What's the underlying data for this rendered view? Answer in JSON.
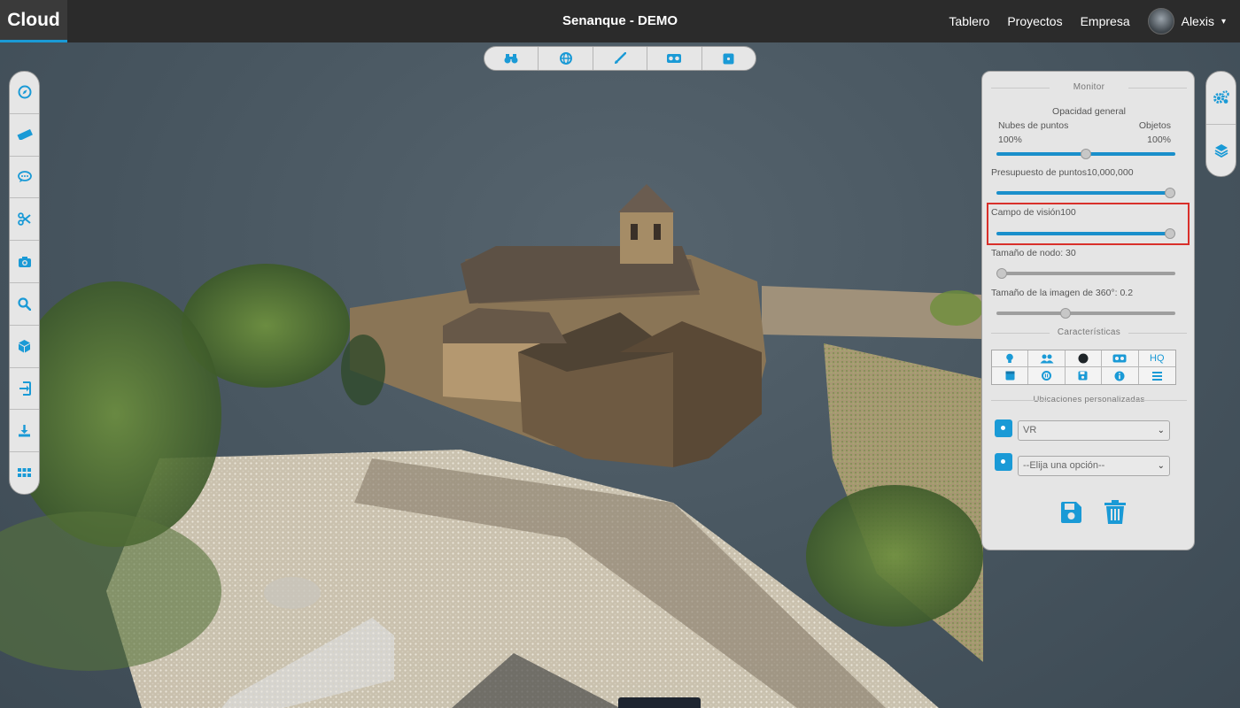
{
  "header": {
    "brand": "Cloud",
    "title": "Senanque - DEMO",
    "nav": [
      "Tablero",
      "Proyectos",
      "Empresa"
    ],
    "user_name": "Alexis"
  },
  "toolbar_top": {
    "buttons": [
      "binoculars-icon",
      "globe-icon",
      "paintbrush-icon",
      "vr-goggles-icon",
      "dice-icon"
    ]
  },
  "toolbar_left": {
    "buttons": [
      "compass-icon",
      "ruler-icon",
      "comment-icon",
      "scissors-icon",
      "camera-icon",
      "search-icon",
      "cube-icon",
      "import-icon",
      "download-icon",
      "grid-icon"
    ]
  },
  "toolbar_right": {
    "buttons": [
      "cogs-icon",
      "layers-icon"
    ]
  },
  "panel": {
    "monitor_title": "Monitor",
    "opacity_label": "Opacidad general",
    "opacity_left_label": "Nubes de puntos",
    "opacity_right_label": "Objetos",
    "opacity_left_value": "100%",
    "opacity_right_value": "100%",
    "opacity_slider_position": 0.5,
    "budget_label": "Presupuesto de puntos10,000,000",
    "budget_fraction": 1.0,
    "fov_label": "Campo de visión100",
    "fov_fraction": 1.0,
    "node_label": "Tamaño de nodo: 30",
    "node_fraction": 0.0,
    "img360_label": "Tamaño de la imagen de 360°: 0.2",
    "img360_fraction": 0.38,
    "features_title": "Características",
    "feature_hq": "HQ",
    "feature_icons": [
      "lightbulb-icon",
      "users-icon",
      "circle-icon",
      "vr-icon",
      "",
      "box-icon",
      "settings-icon",
      "save-icon",
      "info-icon",
      "list-icon"
    ],
    "locations_title": "Ubicaciones personalizadas",
    "select_1_value": "VR",
    "select_2_value": "--Elija una opción--",
    "accent_color": "#1a9ad6",
    "highlight_color": "#d9302b"
  }
}
